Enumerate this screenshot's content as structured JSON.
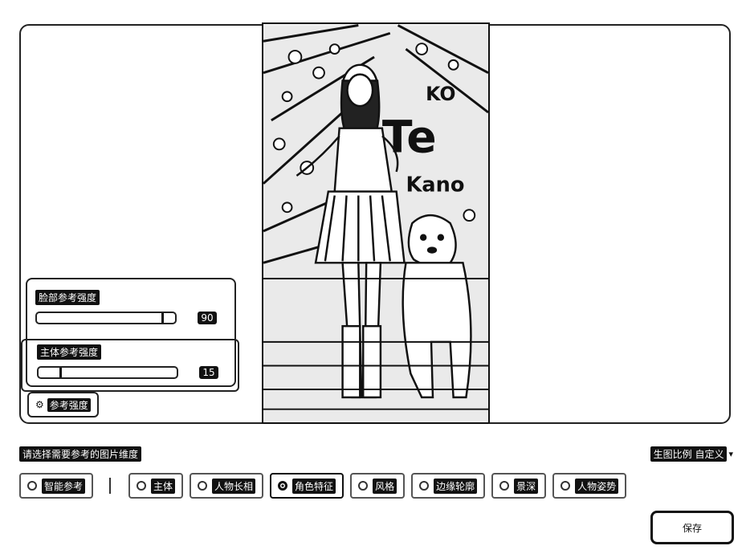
{
  "preview": {
    "alt": "参考图片预览",
    "logo_letters": [
      "KO",
      "Te",
      "Kano"
    ]
  },
  "sliders": {
    "face": {
      "label": "脸部参考强度",
      "value": "90",
      "fill_fraction": 0.9
    },
    "subject": {
      "label": "主体参考强度",
      "value": "15",
      "fill_fraction": 0.15
    }
  },
  "reference_button": {
    "label": "参考强度",
    "icon": "gear-icon"
  },
  "hint": "请选择需要参考的图片维度",
  "ratio": {
    "label": "生图比例 自定义",
    "icon": "chevron-down-icon"
  },
  "options": [
    {
      "label": "智能参考",
      "active": false
    },
    {
      "label": "主体",
      "active": false
    },
    {
      "label": "人物长相",
      "active": false
    },
    {
      "label": "角色特征",
      "active": true
    },
    {
      "label": "风格",
      "active": false
    },
    {
      "label": "边缘轮廓",
      "active": false
    },
    {
      "label": "景深",
      "active": false
    },
    {
      "label": "人物姿势",
      "active": false
    }
  ],
  "save_label": "保存"
}
